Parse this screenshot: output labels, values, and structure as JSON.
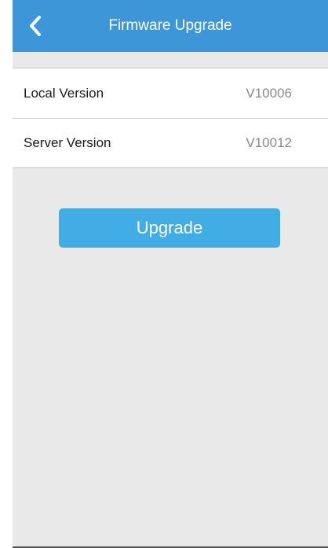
{
  "header": {
    "title": "Firmware Upgrade",
    "back_icon": "chevron-left-icon"
  },
  "versions": [
    {
      "label": "Local Version",
      "value": "V10006"
    },
    {
      "label": "Server Version",
      "value": "V10012"
    }
  ],
  "actions": {
    "upgrade_label": "Upgrade"
  },
  "colors": {
    "header": "#3d96d8",
    "button": "#41ade4",
    "background": "#e9e9e9"
  }
}
